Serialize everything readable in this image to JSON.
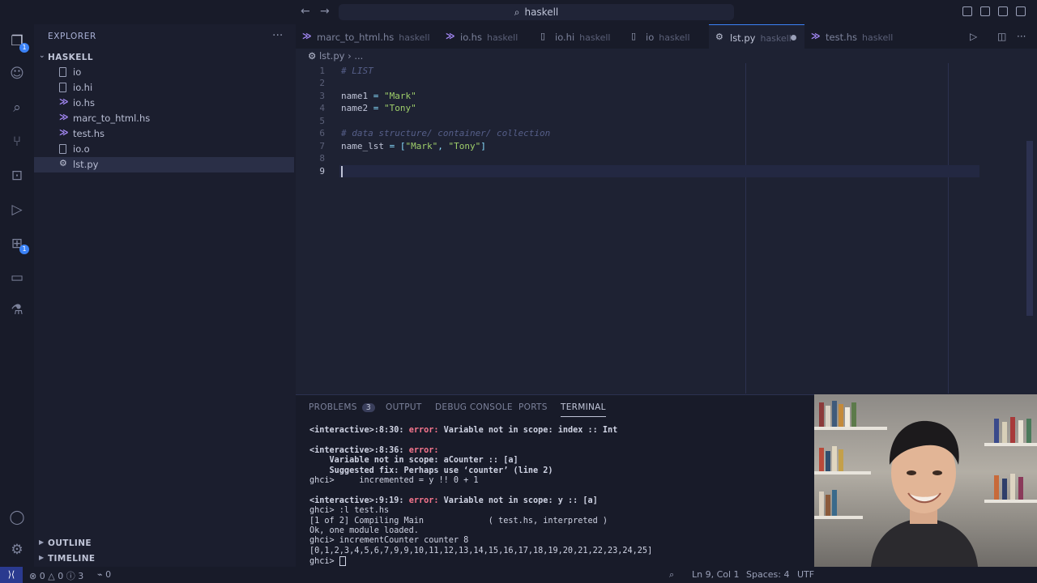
{
  "titlebar": {
    "search_text": "haskell"
  },
  "activity_bar": {
    "explorer_badge": "1",
    "extensions_badge": "1"
  },
  "sidebar": {
    "title": "EXPLORER",
    "folder": "HASKELL",
    "files": [
      {
        "name": "io",
        "type": "file"
      },
      {
        "name": "io.hi",
        "type": "file"
      },
      {
        "name": "io.hs",
        "type": "haskell"
      },
      {
        "name": "marc_to_html.hs",
        "type": "haskell"
      },
      {
        "name": "test.hs",
        "type": "haskell"
      },
      {
        "name": "io.o",
        "type": "file"
      },
      {
        "name": "lst.py",
        "type": "python",
        "selected": true
      }
    ],
    "outline_label": "OUTLINE",
    "timeline_label": "TIMELINE"
  },
  "tabs": [
    {
      "label": "marc_to_html.hs",
      "desc": "haskell"
    },
    {
      "label": "io.hs",
      "desc": "haskell"
    },
    {
      "label": "io.hi",
      "desc": "haskell"
    },
    {
      "label": "io",
      "desc": "haskell"
    },
    {
      "label": "lst.py",
      "desc": "haskell",
      "active": true,
      "modified": true
    },
    {
      "label": "test.hs",
      "desc": "haskell"
    }
  ],
  "breadcrumb": {
    "file": "lst.py",
    "rest": "..."
  },
  "editor": {
    "lines": [
      {
        "num": "1",
        "text": "# LIST"
      },
      {
        "num": "2",
        "text": ""
      },
      {
        "num": "3",
        "text": "name1 = \"Mark\""
      },
      {
        "num": "4",
        "text": "name2 = \"Tony\""
      },
      {
        "num": "5",
        "text": ""
      },
      {
        "num": "6",
        "text": "# data structure/ container/ collection"
      },
      {
        "num": "7",
        "text": "name_lst = [\"Mark\", \"Tony\"]"
      },
      {
        "num": "8",
        "text": ""
      },
      {
        "num": "9",
        "text": ""
      }
    ]
  },
  "panel": {
    "tabs": [
      "PROBLEMS",
      "OUTPUT",
      "DEBUG CONSOLE",
      "PORTS",
      "TERMINAL"
    ],
    "problems_count": "3",
    "active_tab": "TERMINAL",
    "terminal": {
      "l1_loc": "<interactive>:8:30:",
      "l1_err": "error:",
      "l1_msg": "Variable not in scope: index :: Int",
      "l2_loc": "<interactive>:8:36:",
      "l2_err": "error:",
      "l3": "    Variable not in scope: aCounter :: [a]",
      "l4": "    Suggested fix: Perhaps use ‘counter’ (line 2)",
      "l5": "ghci>     incremented = y !! 0 + 1",
      "l6_loc": "<interactive>:9:19:",
      "l6_err": "error:",
      "l6_msg": "Variable not in scope: y :: [a]",
      "l7": "ghci> :l test.hs",
      "l8": "[1 of 2] Compiling Main             ( test.hs, interpreted )",
      "l9": "Ok, one module loaded.",
      "l10": "ghci> incrementCounter counter 8",
      "l11": "[0,1,2,3,4,5,6,7,9,9,10,11,12,13,14,15,16,17,18,19,20,21,22,23,24,25]",
      "l12": "ghci> "
    }
  },
  "statusbar": {
    "errors": "0",
    "warnings": "0",
    "info": "3",
    "ports": "0",
    "position": "Ln 9, Col 1",
    "spaces": "Spaces: 4",
    "encoding": "UTF"
  },
  "colors": {
    "accent": "#3b82f6",
    "background": "#1e2233",
    "error": "#f7768e"
  }
}
